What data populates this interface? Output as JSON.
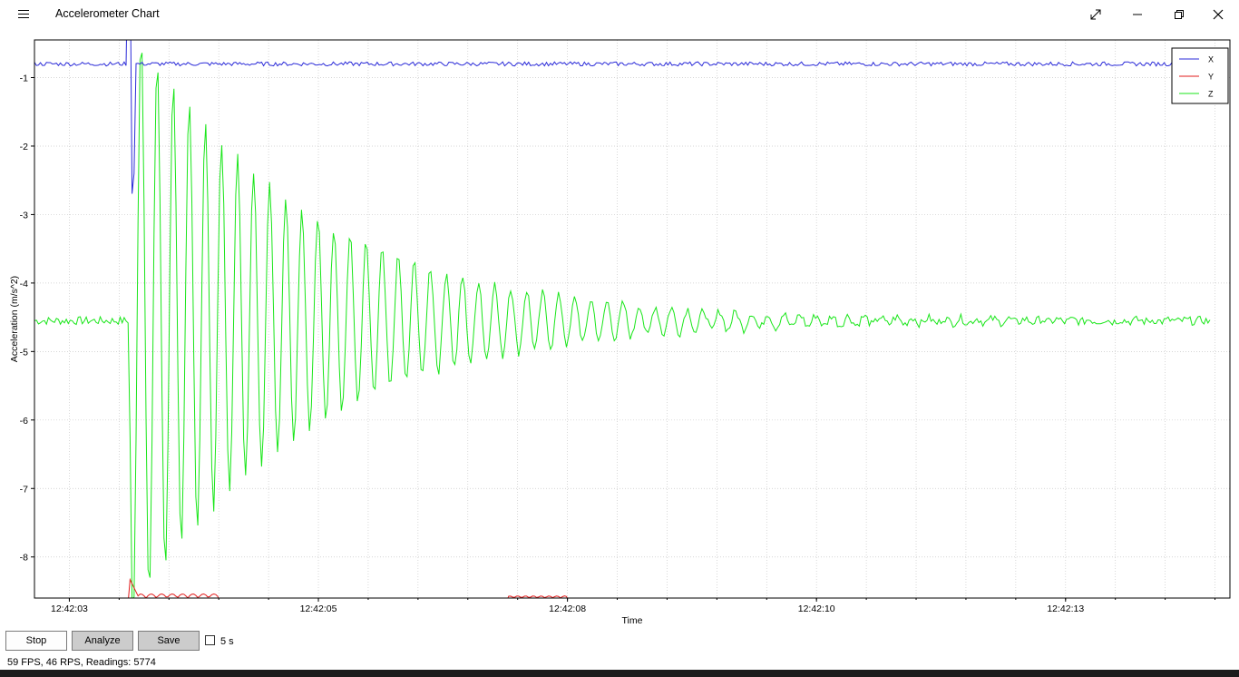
{
  "window": {
    "title": "Accelerometer Chart",
    "menu_icon": "hamburger-menu-icon",
    "controls": [
      "expand-icon",
      "minimize-icon",
      "maximize-icon",
      "close-icon"
    ]
  },
  "colors": {
    "x": "#2a2ad8",
    "y": "#e21b1b",
    "z": "#19e619",
    "grid": "#c8c8c8"
  },
  "chart_data": {
    "type": "line",
    "xlabel": "Time",
    "ylabel": "Acceleration (m/s^2)",
    "xticks": [
      "12:42:03",
      "12:42:05",
      "12:42:08",
      "12:42:10",
      "12:42:13"
    ],
    "xtick_seconds": [
      3,
      5.5,
      8,
      10.5,
      13
    ],
    "xlim_seconds": [
      2.65,
      14.65
    ],
    "yticks": [
      -1,
      -2,
      -3,
      -4,
      -5,
      -6,
      -7,
      -8
    ],
    "ylim": [
      -8.6,
      -0.45
    ],
    "grid": true,
    "legend_position": "top-right",
    "series": [
      {
        "name": "X",
        "baseline": -0.8,
        "noise": 0.02
      },
      {
        "name": "Y",
        "baseline": -8.6,
        "note": "mostly below visible range; small peak ~-8.3 at start"
      },
      {
        "name": "Z",
        "baseline": -4.55,
        "event_start_seconds": 3.6,
        "peak_amplitude": 4.5,
        "decay_per_second": 0.58,
        "oscillation_hz": 6.2
      }
    ]
  },
  "controls": {
    "stop_label": "Stop",
    "analyze_label": "Analyze",
    "save_label": "Save",
    "window_label": "5 s",
    "window_checked": false
  },
  "status": "59 FPS, 46 RPS, Readings: 5774"
}
